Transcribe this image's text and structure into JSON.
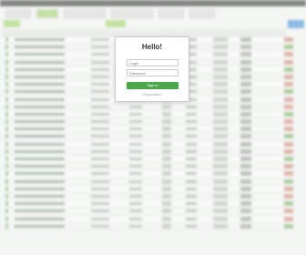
{
  "modal": {
    "title": "Hello!",
    "login_placeholder": "Login",
    "password_placeholder": "Password",
    "sign_in_label": "Sign in",
    "register_link": "Registration"
  },
  "colors": {
    "accent": "#4aa84a",
    "primary": "#4a90d4",
    "tab_green": "#9fcf6a"
  },
  "background_rows": 26
}
